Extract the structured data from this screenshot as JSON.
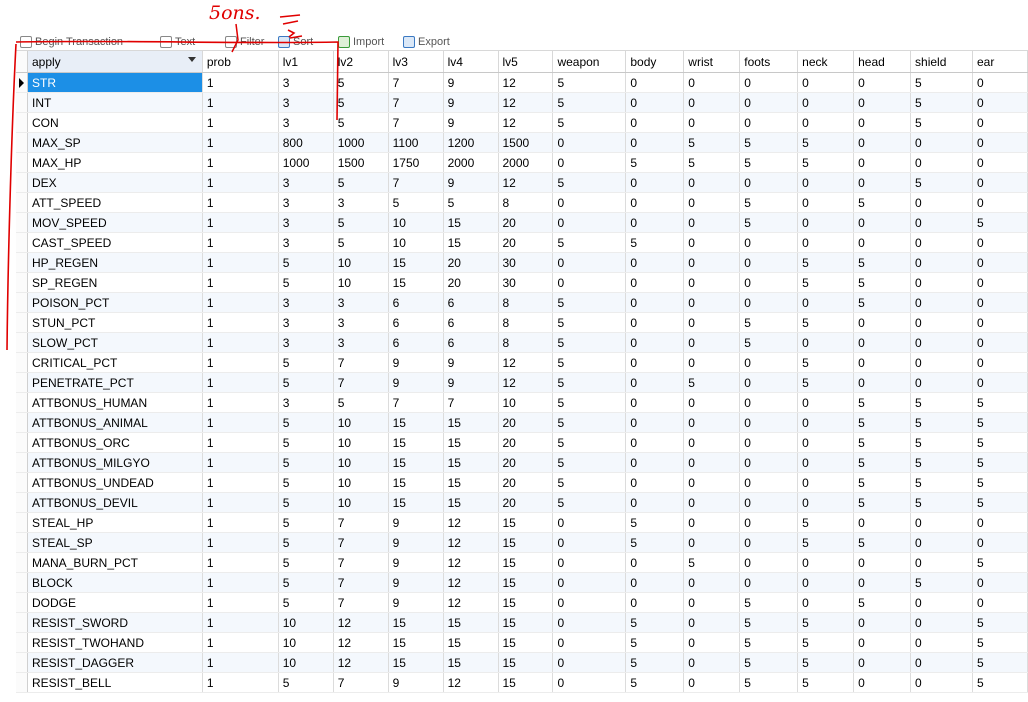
{
  "toolbar": {
    "items": [
      {
        "label": "Begin Transaction",
        "icon": "transaction-icon"
      },
      {
        "label": "Text",
        "icon": "text-icon"
      },
      {
        "label": "Filter",
        "icon": "filter-icon"
      },
      {
        "label": "Sort",
        "icon": "sort-icon"
      },
      {
        "label": "Import",
        "icon": "import-icon"
      },
      {
        "label": "Export",
        "icon": "export-icon"
      }
    ]
  },
  "annotation": {
    "handwritten_note": "5ons.",
    "color": "#e00000"
  },
  "grid": {
    "columns": [
      "apply",
      "prob",
      "lv1",
      "lv2",
      "lv3",
      "lv4",
      "lv5",
      "weapon",
      "body",
      "wrist",
      "foots",
      "neck",
      "head",
      "shield",
      "ear"
    ],
    "rows": [
      [
        "STR",
        "1",
        "3",
        "5",
        "7",
        "9",
        "12",
        "5",
        "0",
        "0",
        "0",
        "0",
        "0",
        "5",
        "0"
      ],
      [
        "INT",
        "1",
        "3",
        "5",
        "7",
        "9",
        "12",
        "5",
        "0",
        "0",
        "0",
        "0",
        "0",
        "5",
        "0"
      ],
      [
        "CON",
        "1",
        "3",
        "5",
        "7",
        "9",
        "12",
        "5",
        "0",
        "0",
        "0",
        "0",
        "0",
        "5",
        "0"
      ],
      [
        "MAX_SP",
        "1",
        "800",
        "1000",
        "1100",
        "1200",
        "1500",
        "0",
        "0",
        "5",
        "5",
        "5",
        "0",
        "0",
        "0"
      ],
      [
        "MAX_HP",
        "1",
        "1000",
        "1500",
        "1750",
        "2000",
        "2000",
        "0",
        "5",
        "5",
        "5",
        "5",
        "0",
        "0",
        "0"
      ],
      [
        "DEX",
        "1",
        "3",
        "5",
        "7",
        "9",
        "12",
        "5",
        "0",
        "0",
        "0",
        "0",
        "0",
        "5",
        "0"
      ],
      [
        "ATT_SPEED",
        "1",
        "3",
        "3",
        "5",
        "5",
        "8",
        "0",
        "0",
        "0",
        "5",
        "0",
        "5",
        "0",
        "0"
      ],
      [
        "MOV_SPEED",
        "1",
        "3",
        "5",
        "10",
        "15",
        "20",
        "0",
        "0",
        "0",
        "5",
        "0",
        "0",
        "0",
        "5"
      ],
      [
        "CAST_SPEED",
        "1",
        "3",
        "5",
        "10",
        "15",
        "20",
        "5",
        "5",
        "0",
        "0",
        "0",
        "0",
        "0",
        "0"
      ],
      [
        "HP_REGEN",
        "1",
        "5",
        "10",
        "15",
        "20",
        "30",
        "0",
        "0",
        "0",
        "0",
        "5",
        "5",
        "0",
        "0"
      ],
      [
        "SP_REGEN",
        "1",
        "5",
        "10",
        "15",
        "20",
        "30",
        "0",
        "0",
        "0",
        "0",
        "5",
        "5",
        "0",
        "0"
      ],
      [
        "POISON_PCT",
        "1",
        "3",
        "3",
        "6",
        "6",
        "8",
        "5",
        "0",
        "0",
        "0",
        "0",
        "5",
        "0",
        "0"
      ],
      [
        "STUN_PCT",
        "1",
        "3",
        "3",
        "6",
        "6",
        "8",
        "5",
        "0",
        "0",
        "5",
        "5",
        "0",
        "0",
        "0"
      ],
      [
        "SLOW_PCT",
        "1",
        "3",
        "3",
        "6",
        "6",
        "8",
        "5",
        "0",
        "0",
        "5",
        "0",
        "0",
        "0",
        "0"
      ],
      [
        "CRITICAL_PCT",
        "1",
        "5",
        "7",
        "9",
        "9",
        "12",
        "5",
        "0",
        "0",
        "0",
        "5",
        "0",
        "0",
        "0"
      ],
      [
        "PENETRATE_PCT",
        "1",
        "5",
        "7",
        "9",
        "9",
        "12",
        "5",
        "0",
        "5",
        "0",
        "5",
        "0",
        "0",
        "0"
      ],
      [
        "ATTBONUS_HUMAN",
        "1",
        "3",
        "5",
        "7",
        "7",
        "10",
        "5",
        "0",
        "0",
        "0",
        "0",
        "5",
        "5",
        "5"
      ],
      [
        "ATTBONUS_ANIMAL",
        "1",
        "5",
        "10",
        "15",
        "15",
        "20",
        "5",
        "0",
        "0",
        "0",
        "0",
        "5",
        "5",
        "5"
      ],
      [
        "ATTBONUS_ORC",
        "1",
        "5",
        "10",
        "15",
        "15",
        "20",
        "5",
        "0",
        "0",
        "0",
        "0",
        "5",
        "5",
        "5"
      ],
      [
        "ATTBONUS_MILGYO",
        "1",
        "5",
        "10",
        "15",
        "15",
        "20",
        "5",
        "0",
        "0",
        "0",
        "0",
        "5",
        "5",
        "5"
      ],
      [
        "ATTBONUS_UNDEAD",
        "1",
        "5",
        "10",
        "15",
        "15",
        "20",
        "5",
        "0",
        "0",
        "0",
        "0",
        "5",
        "5",
        "5"
      ],
      [
        "ATTBONUS_DEVIL",
        "1",
        "5",
        "10",
        "15",
        "15",
        "20",
        "5",
        "0",
        "0",
        "0",
        "0",
        "5",
        "5",
        "5"
      ],
      [
        "STEAL_HP",
        "1",
        "5",
        "7",
        "9",
        "12",
        "15",
        "0",
        "5",
        "0",
        "0",
        "5",
        "0",
        "0",
        "0"
      ],
      [
        "STEAL_SP",
        "1",
        "5",
        "7",
        "9",
        "12",
        "15",
        "0",
        "5",
        "0",
        "0",
        "5",
        "5",
        "0",
        "0"
      ],
      [
        "MANA_BURN_PCT",
        "1",
        "5",
        "7",
        "9",
        "12",
        "15",
        "0",
        "0",
        "5",
        "0",
        "0",
        "0",
        "0",
        "5"
      ],
      [
        "BLOCK",
        "1",
        "5",
        "7",
        "9",
        "12",
        "15",
        "0",
        "0",
        "0",
        "0",
        "0",
        "0",
        "5",
        "0"
      ],
      [
        "DODGE",
        "1",
        "5",
        "7",
        "9",
        "12",
        "15",
        "0",
        "0",
        "0",
        "5",
        "0",
        "5",
        "0",
        "0"
      ],
      [
        "RESIST_SWORD",
        "1",
        "10",
        "12",
        "15",
        "15",
        "15",
        "0",
        "5",
        "0",
        "5",
        "5",
        "0",
        "0",
        "5"
      ],
      [
        "RESIST_TWOHAND",
        "1",
        "10",
        "12",
        "15",
        "15",
        "15",
        "0",
        "5",
        "0",
        "5",
        "5",
        "0",
        "0",
        "5"
      ],
      [
        "RESIST_DAGGER",
        "1",
        "10",
        "12",
        "15",
        "15",
        "15",
        "0",
        "5",
        "0",
        "5",
        "5",
        "0",
        "0",
        "5"
      ],
      [
        "RESIST_BELL",
        "1",
        "5",
        "7",
        "9",
        "12",
        "15",
        "0",
        "5",
        "0",
        "5",
        "5",
        "0",
        "0",
        "5"
      ]
    ],
    "selected_cell": "STR"
  }
}
